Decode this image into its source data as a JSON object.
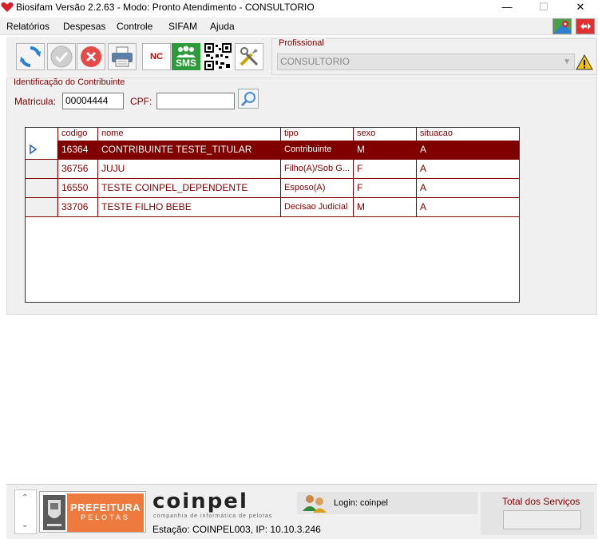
{
  "window": {
    "title": "Biosifam Versão 2.2.63 - Modo: Pronto Atendimento - CONSULTORIO",
    "minimize": "—",
    "maximize": "☐",
    "close": "✕"
  },
  "menu": {
    "items": [
      "Relatórios",
      "Despesas",
      "Controle",
      "SIFAM",
      "Ajuda"
    ]
  },
  "toolbar": {
    "nc_label": "NC",
    "sms_label": "SMS"
  },
  "profissional": {
    "label": "Profissional",
    "value": "CONSULTORIO"
  },
  "identificacao": {
    "group_label": "Identificação do Contribuinte",
    "matricula_label": "Matricula:",
    "matricula_value": "00004444",
    "cpf_label": "CPF:",
    "cpf_value": ""
  },
  "grid": {
    "columns": [
      "codigo",
      "nome",
      "tipo",
      "sexo",
      "situacao"
    ],
    "rows": [
      {
        "codigo": "16364",
        "nome": "CONTRIBUINTE TESTE_TITULAR",
        "tipo": "Contribuinte",
        "sexo": "M",
        "situacao": "A",
        "selected": true
      },
      {
        "codigo": "36756",
        "nome": "JUJU",
        "tipo": "Filho(A)/Sob G...",
        "sexo": "F",
        "situacao": "A",
        "selected": false
      },
      {
        "codigo": "16550",
        "nome": "TESTE COINPEL_DEPENDENTE",
        "tipo": "Esposo(A)",
        "sexo": "F",
        "situacao": "A",
        "selected": false
      },
      {
        "codigo": "33706",
        "nome": "TESTE FILHO BEBE",
        "tipo": "Decisao Judicial",
        "sexo": "M",
        "situacao": "A",
        "selected": false
      }
    ]
  },
  "status": {
    "prefeitura_line1": "PREFEITURA",
    "prefeitura_line2": "PELOTAS",
    "coinpel_logo": "coinpel",
    "coinpel_sub": "companhia de informática de pelotas",
    "estacao": "Estação: COINPEL003, IP: 10.10.3.246",
    "login": "Login: coinpel",
    "total_label": "Total dos Serviços",
    "total_value": ""
  },
  "colors": {
    "accent": "#800000",
    "selected_row": "#800000",
    "prefeitura_orange": "#ee7a3e",
    "sms_green": "#2e9b3a"
  }
}
